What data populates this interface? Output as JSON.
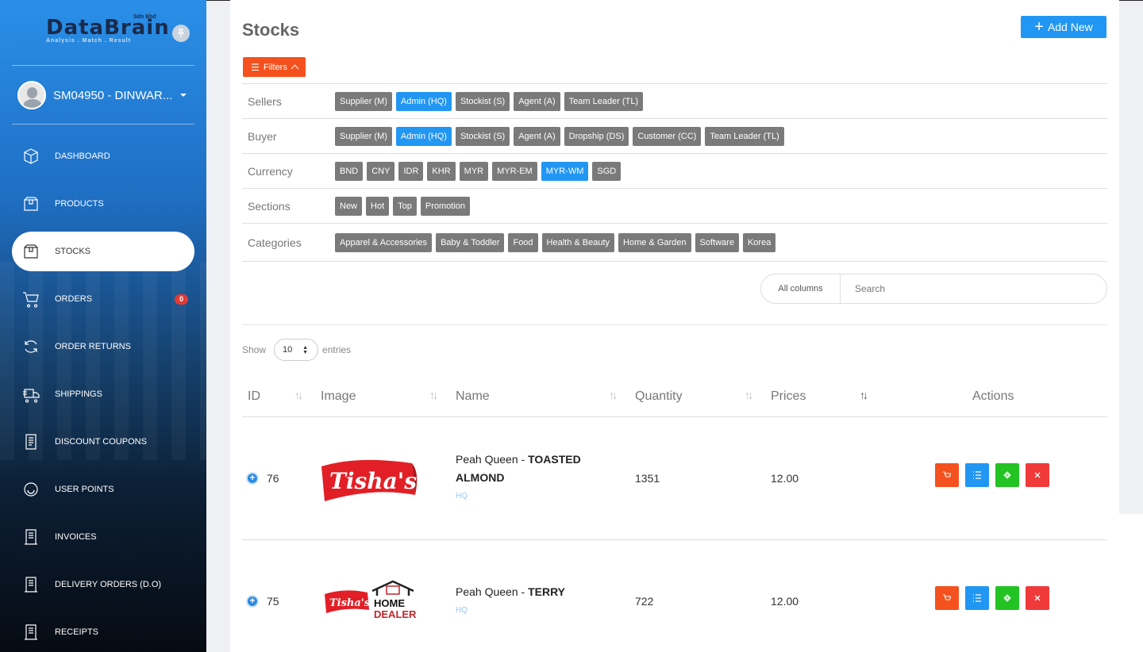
{
  "brand": {
    "name": "DataBrain",
    "suffix": "Sdn Bhd",
    "tagline": "Analysis . Match . Result"
  },
  "user": {
    "name": "SM04950 - DINWAR..."
  },
  "nav": [
    {
      "label": "DASHBOARD",
      "icon": "cube-icon"
    },
    {
      "label": "PRODUCTS",
      "icon": "box-icon"
    },
    {
      "label": "STOCKS",
      "icon": "box-icon",
      "active": true
    },
    {
      "label": "ORDERS",
      "icon": "cart-icon",
      "badge": "0"
    },
    {
      "label": "ORDER RETURNS",
      "icon": "refresh-icon"
    },
    {
      "label": "SHIPPINGS",
      "icon": "truck-icon"
    },
    {
      "label": "DISCOUNT COUPONS",
      "icon": "coupon-icon"
    },
    {
      "label": "USER POINTS",
      "icon": "smile-icon"
    },
    {
      "label": "INVOICES",
      "icon": "document-icon"
    },
    {
      "label": "DELIVERY ORDERS (D.O)",
      "icon": "document-icon"
    },
    {
      "label": "RECEIPTS",
      "icon": "document-icon"
    }
  ],
  "page": {
    "title": "Stocks",
    "add_label": "Add New",
    "filters_label": "Filters"
  },
  "filters": [
    {
      "label": "Sellers",
      "chips": [
        {
          "text": "Supplier (M)"
        },
        {
          "text": "Admin (HQ)",
          "on": true
        },
        {
          "text": "Stockist (S)"
        },
        {
          "text": "Agent (A)"
        },
        {
          "text": "Team Leader (TL)"
        }
      ]
    },
    {
      "label": "Buyer",
      "chips": [
        {
          "text": "Supplier (M)"
        },
        {
          "text": "Admin (HQ)",
          "on": true
        },
        {
          "text": "Stockist (S)"
        },
        {
          "text": "Agent (A)"
        },
        {
          "text": "Dropship (DS)"
        },
        {
          "text": "Customer (CC)"
        },
        {
          "text": "Team Leader (TL)"
        }
      ]
    },
    {
      "label": "Currency",
      "chips": [
        {
          "text": "BND"
        },
        {
          "text": "CNY"
        },
        {
          "text": "IDR"
        },
        {
          "text": "KHR"
        },
        {
          "text": "MYR"
        },
        {
          "text": "MYR-EM"
        },
        {
          "text": "MYR-WM",
          "on": true
        },
        {
          "text": "SGD"
        }
      ]
    },
    {
      "label": "Sections",
      "chips": [
        {
          "text": "New"
        },
        {
          "text": "Hot"
        },
        {
          "text": "Top"
        },
        {
          "text": "Promotion"
        }
      ]
    },
    {
      "label": "Categories",
      "chips": [
        {
          "text": "Apparel & Accessories"
        },
        {
          "text": "Baby & Toddler"
        },
        {
          "text": "Food"
        },
        {
          "text": "Health & Beauty"
        },
        {
          "text": "Home & Garden"
        },
        {
          "text": "Software"
        },
        {
          "text": "Korea"
        }
      ]
    }
  ],
  "search": {
    "scope": "All columns",
    "placeholder": "Search"
  },
  "entries": {
    "show": "Show",
    "value": "10",
    "suffix": "entries"
  },
  "table": {
    "columns": [
      "ID",
      "Image",
      "Name",
      "Quantity",
      "Prices",
      "Actions"
    ],
    "rows": [
      {
        "id": "76",
        "brand": "Peah Queen - ",
        "product": "TOASTED ALMOND",
        "owner": "HQ",
        "quantity": "1351",
        "price": "12.00",
        "logo_text": "Tisha's"
      },
      {
        "id": "75",
        "brand": "Peah Queen - ",
        "product": "TERRY",
        "owner": "HQ",
        "quantity": "722",
        "price": "12.00",
        "logo_text": "Tisha's",
        "logo_extra": "HOME DEALER"
      }
    ]
  },
  "colors": {
    "accent_blue": "#2196f3",
    "accent_orange": "#f4511e",
    "chip_gray": "#7a7a7a",
    "green": "#22c322",
    "red": "#f03a3a"
  }
}
